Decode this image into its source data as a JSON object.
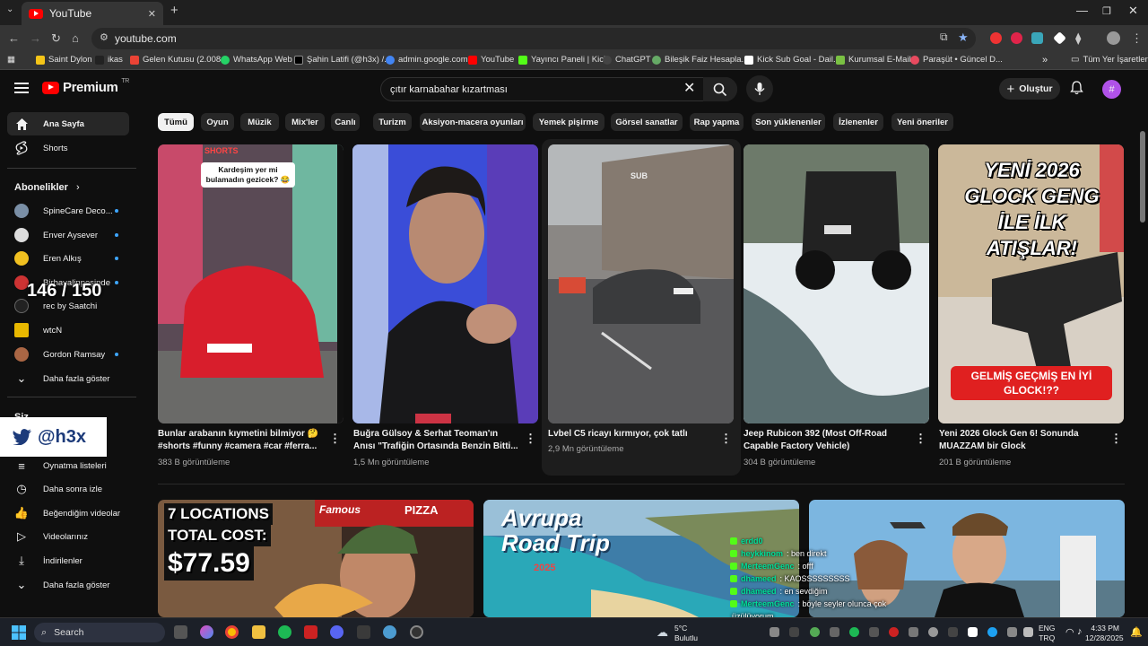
{
  "browser": {
    "tab_title": "YouTube",
    "url": "youtube.com",
    "bookmarks": [
      {
        "label": "Saint Dylon",
        "color": "#f5c518"
      },
      {
        "label": "ikas",
        "color": "#222222"
      },
      {
        "label": "Gelen Kutusu (2.008...",
        "color": "#ea4335"
      },
      {
        "label": "WhatsApp Web",
        "color": "#25d366"
      },
      {
        "label": "Şahin Latifi (@h3x) /...",
        "color": "#000000"
      },
      {
        "label": "admin.google.com",
        "color": "#4285f4"
      },
      {
        "label": "YouTube",
        "color": "#ff0000"
      },
      {
        "label": "Yayıncı Paneli | Kick",
        "color": "#53fc18"
      },
      {
        "label": "ChatGPT",
        "color": "#444444"
      },
      {
        "label": "Bileşik Faiz Hesapla...",
        "color": "#66aa66"
      },
      {
        "label": "Kick Sub Goal - Dail...",
        "color": "#ffffff"
      },
      {
        "label": "Kurumsal E-Mail",
        "color": "#7ac143"
      },
      {
        "label": "Paraşüt • Güncel D...",
        "color": "#e84a5f"
      }
    ],
    "all_bookmarks_label": "Tüm Yer İşaretleri"
  },
  "header": {
    "logo_text": "Premium",
    "logo_region": "TR",
    "search_value": "çıtır karnabahar kızartması",
    "create_label": "Oluştur",
    "avatar_letter": "#"
  },
  "sidebar": {
    "main": [
      {
        "label": "Ana Sayfa",
        "icon": "home-icon"
      },
      {
        "label": "Shorts",
        "icon": "shorts-icon"
      }
    ],
    "subs_heading": "Abonelikler",
    "subscriptions": [
      {
        "label": "SpineCare Deco...",
        "color": "#7a8fa6"
      },
      {
        "label": "Enver Aysever",
        "color": "#dddddd"
      },
      {
        "label": "Eren Alkış",
        "color": "#f0c020"
      },
      {
        "label": "Birhayalinpeşinde",
        "color": "#cc3333"
      },
      {
        "label": "rec by Saatchi",
        "color": "#222222"
      },
      {
        "label": "wtcN",
        "color": "#e8b800"
      },
      {
        "label": "Gordon Ramsay",
        "color": "#aa6644"
      }
    ],
    "subs_more": "Daha fazla göster",
    "you_heading": "Siz",
    "library": [
      {
        "label": "Oynatma listeleri",
        "icon": "playlist-icon"
      },
      {
        "label": "Daha sonra izle",
        "icon": "clock-icon"
      },
      {
        "label": "Beğendiğim videolar",
        "icon": "thumbs-up-icon"
      },
      {
        "label": "Videolarınız",
        "icon": "video-icon"
      },
      {
        "label": "İndirilenler",
        "icon": "download-icon"
      }
    ],
    "library_more": "Daha fazla göster"
  },
  "chips": [
    "Tümü",
    "Oyun",
    "Müzik",
    "Mix'ler",
    "Canlı",
    "Turizm",
    "Aksiyon-macera oyunları",
    "Yemek pişirme",
    "Görsel sanatlar",
    "Rap yapma",
    "Son yüklenenler",
    "İzlenenler",
    "Yeni öneriler"
  ],
  "videos": [
    {
      "title1": "Bunlar arabanın kıymetini bilmiyor 🤔",
      "title2": "#shorts #funny #camera #car #ferra...",
      "views": "383 B görüntüleme",
      "thumb_text": "Kardeşim yer mi bulamadın gezicek? 😂",
      "thumb_badge": "SHORTS"
    },
    {
      "title1": "Buğra Gülsoy & Serhat Teoman'ın",
      "title2": "Anısı \"Trafiğin Ortasında Benzin Bitti...",
      "views": "1,5 Mn görüntüleme"
    },
    {
      "title1": "Lvbel C5 ricayı kırmıyor, çok tatlı",
      "title2": "",
      "views": "2,9 Mn görüntüleme",
      "thumb_text": "SUB"
    },
    {
      "title1": "Jeep Rubicon 392 (Most Off-Road",
      "title2": "Capable Factory Vehicle)",
      "views": "304 B görüntüleme"
    },
    {
      "title1": "Yeni 2026 Glock Gen 6! Sonunda",
      "title2": "MUAZZAM bir Glock",
      "views": "201 B görüntüleme",
      "thumb_text": "YENİ 2026 GLOCK GENG İLE İLK ATIŞLAR!",
      "thumb_banner": "GELMİŞ GEÇMİŞ EN İYİ GLOCK!??"
    }
  ],
  "row2": [
    {
      "line1": "7 LOCATIONS",
      "line2": "TOTAL COST:",
      "line3": "$77.59",
      "sign": "Famous",
      "sign2": "PIZZA"
    },
    {
      "line1": "Avrupa",
      "line2": "Road Trip",
      "line3": "2025"
    },
    {}
  ],
  "overlays": {
    "counter": "146 / 150",
    "twitter_handle": "@h3x",
    "chat": [
      {
        "user": "erdd0",
        "msg": ""
      },
      {
        "user": "heykkinom",
        "msg": ": ben direkt"
      },
      {
        "user": "MerteemGenc",
        "msg": ": offf"
      },
      {
        "user": "dhameed",
        "msg": ": KAOSSSSSSSSS"
      },
      {
        "user": "dhameed",
        "msg": ": en sevdiğim"
      },
      {
        "user": "MerteemGenc",
        "msg": ": böyle seyler olunca çok"
      },
      {
        "user": "",
        "msg": "üzülüyorum"
      }
    ]
  },
  "taskbar": {
    "search_placeholder": "Search",
    "weather_temp": "5°C",
    "weather_desc": "Bulutlu",
    "lang": "ENG",
    "region": "TRQ",
    "time": "4:33 PM",
    "date": "12/28/2025"
  }
}
